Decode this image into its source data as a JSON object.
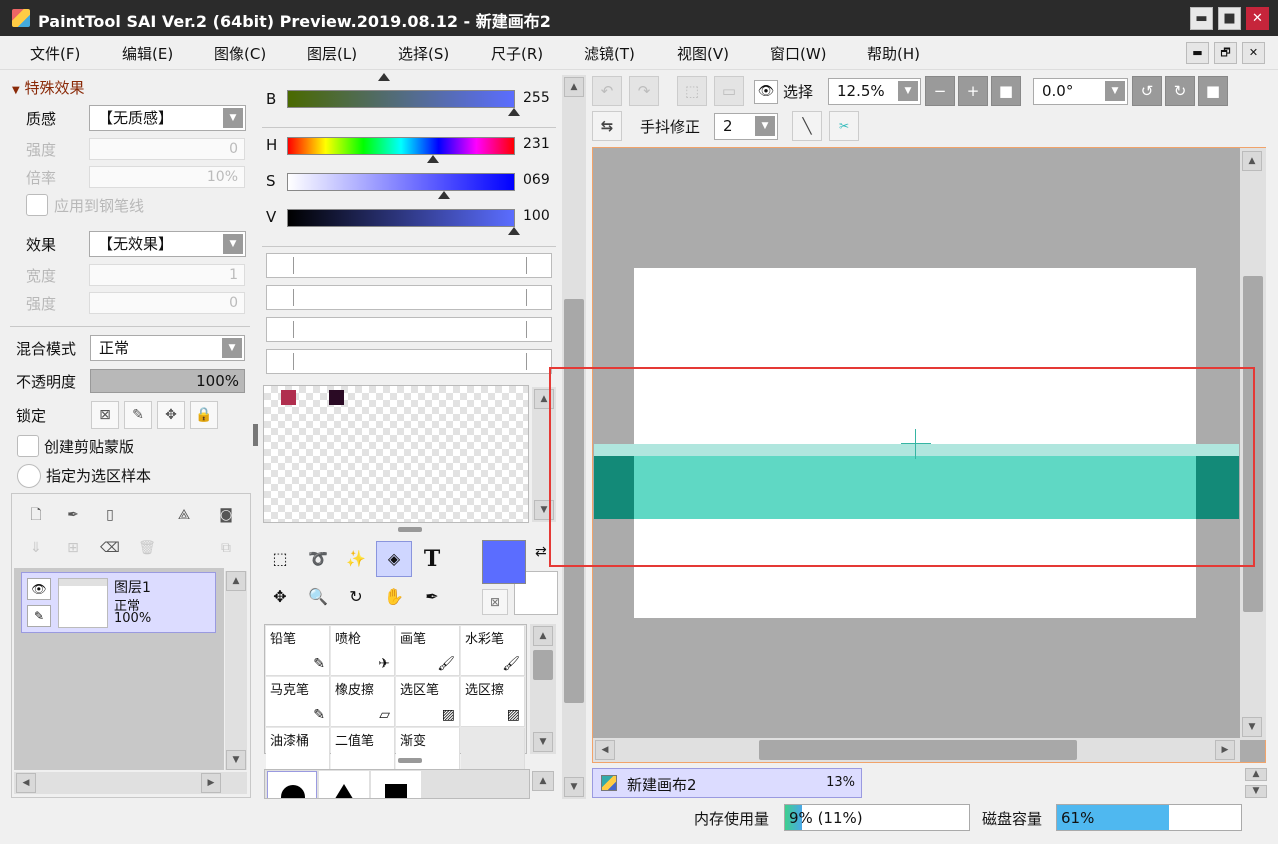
{
  "window": {
    "title": "PaintTool SAI Ver.2 (64bit) Preview.2019.08.12 - 新建画布2",
    "minimize": "▬",
    "maximize": "■",
    "close": "✕"
  },
  "menu": [
    "文件(F)",
    "编辑(E)",
    "图像(C)",
    "图层(L)",
    "选择(S)",
    "尺子(R)",
    "滤镜(T)",
    "视图(V)",
    "窗口(W)",
    "帮助(H)"
  ],
  "mdi": {
    "minimize": "▬",
    "restore": "🗗",
    "close": "✕"
  },
  "special_effects": {
    "header": "特殊效果",
    "texture_label": "质感",
    "texture_value": "【无质感】",
    "strength_label": "强度",
    "strength_value": "0",
    "scale_label": "倍率",
    "scale_value": "10%",
    "apply_pen_label": "应用到钢笔线",
    "effect_label": "效果",
    "effect_value": "【无效果】",
    "width_label": "宽度",
    "width_value": "1",
    "effect_strength_label": "强度",
    "effect_strength_value": "0"
  },
  "layer_props": {
    "blend_label": "混合模式",
    "blend_value": "正常",
    "opacity_label": "不透明度",
    "opacity_value": "100%",
    "opacity_fraction": 1.0,
    "lock_label": "锁定",
    "clip_label": "创建剪贴蒙版",
    "selection_source_label": "指定为选区样本"
  },
  "layers": [
    {
      "name": "图层1",
      "mode": "正常",
      "opacity": "100%"
    }
  ],
  "color": {
    "b_label": "B",
    "b_value": "255",
    "h_label": "H",
    "h_value": "231",
    "s_label": "S",
    "s_value": "069",
    "v_label": "V",
    "v_value": "100",
    "primary": "#5b6dff",
    "secondary": "#ffffff",
    "swatches": [
      "#b02e4e",
      "#2a0a24"
    ]
  },
  "tools_row1": [
    "selection-rect",
    "lasso",
    "magic-wand",
    "shape",
    "text"
  ],
  "brushes": [
    {
      "name": "铅笔",
      "icon": "✎"
    },
    {
      "name": "喷枪",
      "icon": "✈"
    },
    {
      "name": "画笔",
      "icon": "🖌"
    },
    {
      "name": "水彩笔",
      "icon": "🖌"
    },
    {
      "name": "马克笔",
      "icon": "✎"
    },
    {
      "name": "橡皮擦",
      "icon": "▱"
    },
    {
      "name": "选区笔",
      "icon": "▨"
    },
    {
      "name": "选区擦",
      "icon": "▨"
    },
    {
      "name": "油漆桶",
      "icon": ""
    },
    {
      "name": "二值笔",
      "icon": ""
    },
    {
      "name": "渐变",
      "icon": ""
    },
    {
      "name": "",
      "icon": ""
    }
  ],
  "toolbar": {
    "select_label": "选择",
    "zoom_value": "12.5%",
    "angle_value": "0.0°",
    "stabilizer_label": "手抖修正",
    "stabilizer_value": "2"
  },
  "canvas_tab": {
    "name": "新建画布2",
    "zoom": "13%"
  },
  "status": {
    "memory_label": "内存使用量",
    "memory_value": "9% (11%)",
    "memory_fraction": 0.09,
    "disk_label": "磁盘容量",
    "disk_value": "61%",
    "disk_fraction": 0.61
  },
  "colors": {
    "accent": "#5b6dff",
    "teal": "#5fd8c4",
    "teal_dark": "#138a78",
    "highlight": "#e53935"
  }
}
